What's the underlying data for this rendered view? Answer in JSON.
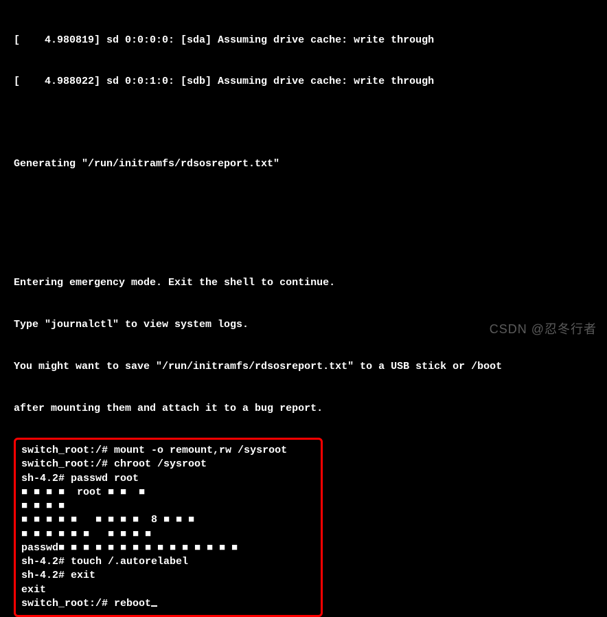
{
  "boot": {
    "line1": "[    4.980819] sd 0:0:0:0: [sda] Assuming drive cache: write through",
    "line2": "[    4.988022] sd 0:0:1:0: [sdb] Assuming drive cache: write through",
    "generating": "Generating \"/run/initramfs/rdsosreport.txt\"",
    "emergency1": "Entering emergency mode. Exit the shell to continue.",
    "emergency2": "Type \"journalctl\" to view system logs.",
    "emergency3": "You might want to save \"/run/initramfs/rdsosreport.txt\" to a USB stick or /boot",
    "emergency4": "after mounting them and attach it to a bug report."
  },
  "commands": {
    "c1_prompt": "switch_root:/# ",
    "c1_cmd": "mount -o remount,rw /sysroot",
    "c2_prompt": "switch_root:/# ",
    "c2_cmd": "chroot /sysroot",
    "c3_prompt": "sh-4.2# ",
    "c3_cmd": "passwd root",
    "out1": "■ ■ ■ ■  root ■ ■  ■",
    "out2": "■ ■ ■ ■",
    "out3": "■ ■ ■ ■ ■   ■ ■ ■ ■  8 ■ ■ ■",
    "out4": "■ ■ ■ ■ ■ ■   ■ ■ ■ ■",
    "out5": "passwd■ ■ ■ ■ ■ ■ ■ ■ ■ ■ ■ ■ ■ ■ ■",
    "c4_prompt": "sh-4.2# ",
    "c4_cmd": "touch /.autorelabel",
    "c5_prompt": "sh-4.2# ",
    "c5_cmd": "exit",
    "exit_echo": "exit",
    "c6_prompt": "switch_root:/# ",
    "c6_cmd": "reboot"
  },
  "watermark": "CSDN @忍冬行者"
}
